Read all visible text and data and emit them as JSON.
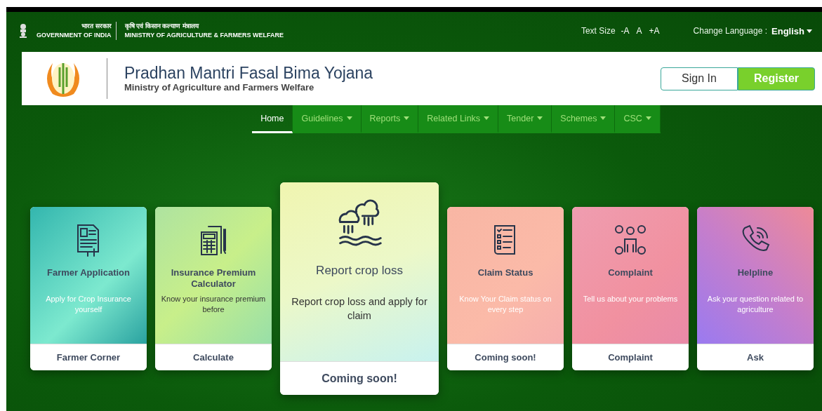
{
  "gov_bar": {
    "hindi_left": "भारत सरकार",
    "english_left": "GOVERNMENT OF INDIA",
    "hindi_right": "कृषि एवं किसान कल्याण मंत्रालय",
    "english_right": "MINISTRY OF AGRICULTURE & FARMERS WELFARE",
    "text_size": {
      "label": "Text Size",
      "options": [
        "-A",
        "A",
        "+A"
      ]
    },
    "language": {
      "label": "Change Language :",
      "value": "English"
    }
  },
  "header": {
    "title": "Pradhan Mantri Fasal Bima Yojana",
    "subtitle": "Ministry of Agriculture and Farmers Welfare",
    "buttons": [
      {
        "label": "Sign In",
        "kind": "outline"
      },
      {
        "label": "Register",
        "kind": "filled"
      }
    ]
  },
  "nav": [
    {
      "label": "Home",
      "selected": true,
      "dropdown": false
    },
    {
      "label": "Guidelines",
      "selected": false,
      "dropdown": true
    },
    {
      "label": "Reports",
      "selected": false,
      "dropdown": true
    },
    {
      "label": "Related Links",
      "selected": false,
      "dropdown": true
    },
    {
      "label": "Tender",
      "selected": false,
      "dropdown": true
    },
    {
      "label": "Schemes",
      "selected": false,
      "dropdown": true
    },
    {
      "label": "CSC",
      "selected": false,
      "dropdown": true
    }
  ],
  "cards": [
    {
      "kind": "application",
      "title": "Farmer Application",
      "description": "Apply for Crop Insurance yourself",
      "action": "Farmer Corner",
      "featured": false
    },
    {
      "kind": "calculator",
      "title": "Insurance Premium Calculator",
      "description": "Know your insurance premium before",
      "action": "Calculate",
      "featured": false
    },
    {
      "kind": "croploss",
      "title": "Report crop loss",
      "description": "Report crop loss and apply for claim",
      "action": "Coming soon!",
      "featured": true
    },
    {
      "kind": "claim",
      "title": "Claim Status",
      "description": "Know Your Claim status on every step",
      "action": "Coming soon!",
      "featured": false
    },
    {
      "kind": "complaint",
      "title": "Complaint",
      "description": "Tell us about your problems",
      "action": "Complaint",
      "featured": false
    },
    {
      "kind": "helpline",
      "title": "Helpline",
      "description": "Ask your question related to agriculture",
      "action": "Ask",
      "featured": false
    }
  ]
}
